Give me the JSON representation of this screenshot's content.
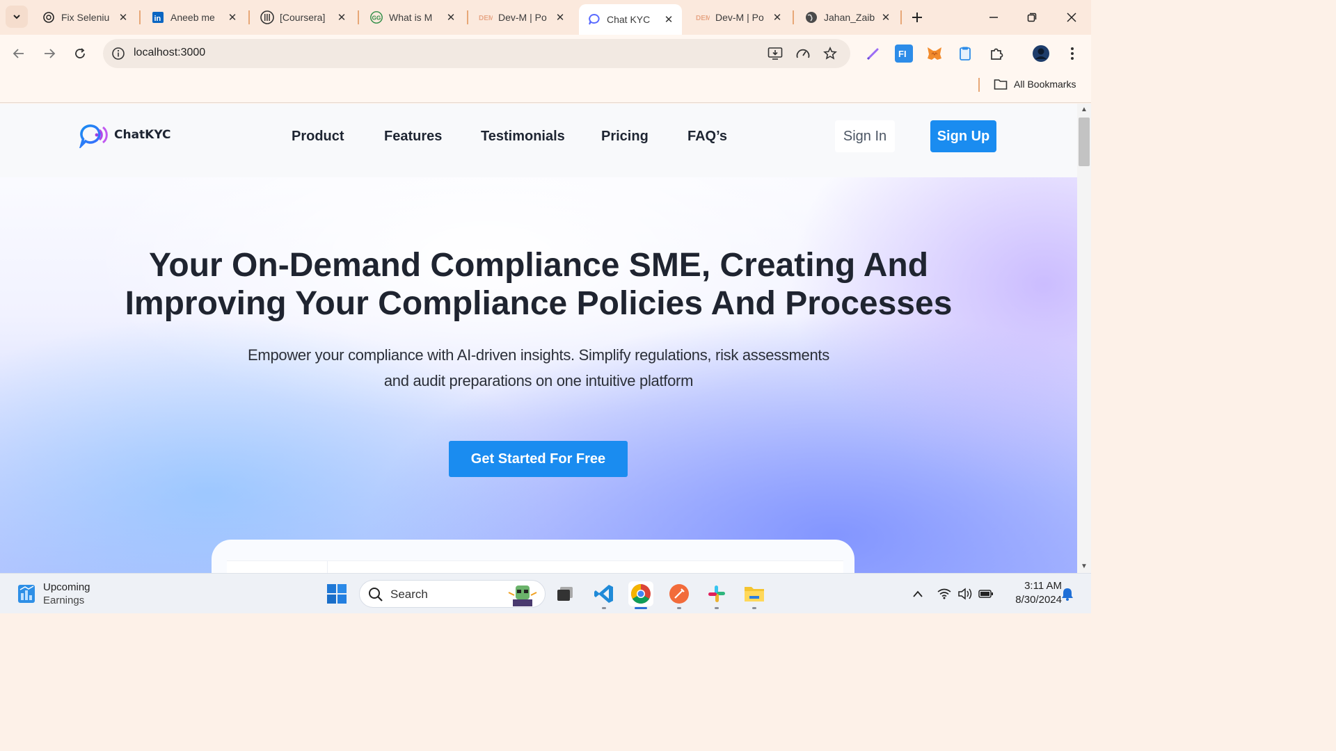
{
  "browser": {
    "tabs": [
      {
        "title": "Fix Seleniu",
        "icon": "openai-icon"
      },
      {
        "title": "Aneeb me",
        "icon": "linkedin-icon"
      },
      {
        "title": "[Coursera]",
        "icon": "coursera-icon"
      },
      {
        "title": "What is M",
        "icon": "geeksforgeeks-icon"
      },
      {
        "title": "Dev-M | Po",
        "icon": "devm-icon"
      },
      {
        "title": "Chat KYC",
        "icon": "chatkyc-icon",
        "active": true
      },
      {
        "title": "Dev-M | Po",
        "icon": "devm-icon"
      },
      {
        "title": "Jahan_Zaib",
        "icon": "globe-icon"
      }
    ],
    "close_glyph": "✕",
    "url": "localhost:3000",
    "bookmarks_label": "All Bookmarks"
  },
  "site": {
    "brand": "ChatKYC",
    "nav": [
      "Product",
      "Features",
      "Testimonials",
      "Pricing",
      "FAQ’s"
    ],
    "sign_in": "Sign In",
    "sign_up": "Sign Up",
    "hero_title_line1": "Your On-Demand Compliance SME, Creating And",
    "hero_title_line2": "Improving Your Compliance Policies And Processes",
    "hero_sub_line1": "Empower your compliance with AI-driven insights. Simplify regulations, risk assessments",
    "hero_sub_line2": "and audit preparations on one intuitive platform",
    "cta": "Get Started For Free",
    "accent_color": "#1a8cf0"
  },
  "taskbar": {
    "widget_title": "Upcoming",
    "widget_sub": "Earnings",
    "search_label": "Search",
    "time": "3:11 AM",
    "date": "8/30/2024"
  }
}
